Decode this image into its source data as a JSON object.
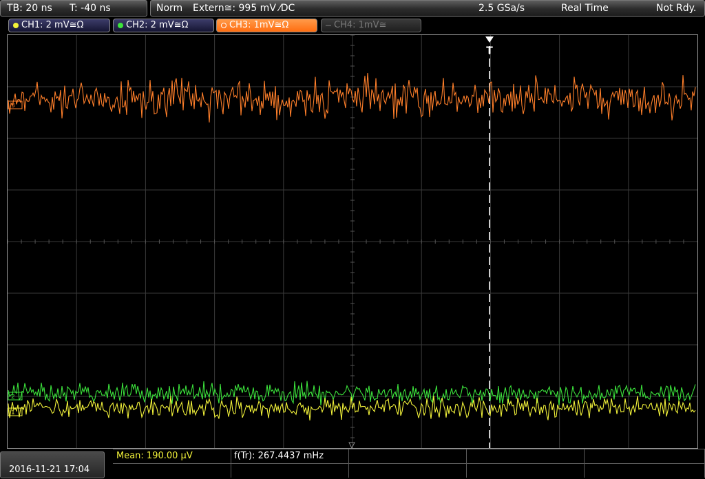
{
  "top_bar": {
    "timebase": "TB: 20 ns",
    "trigger_offset": "T: -40 ns",
    "acq_mode": "Norm",
    "trigger_info": "Extern≅: 995 mV ⁄DC",
    "sample_rate": "2.5 GSa/s",
    "time_mode": "Real Time",
    "status": "Not Rdy."
  },
  "channels": [
    {
      "label": "CH1: 2 mV≅Ω",
      "color": "#f2f23a",
      "active": true
    },
    {
      "label": "CH2: 2 mV≅Ω",
      "color": "#3ce33c",
      "active": true
    },
    {
      "label": "CH3: 1mV≅Ω",
      "color": "#ff7f2a",
      "active": true,
      "selected": true
    },
    {
      "label": "CH4: 1mV≅",
      "color": "#6a6a6a",
      "active": false
    }
  ],
  "trigger_marker": "T",
  "channel_markers": {
    "ch1": "1",
    "ch2": "2",
    "ch3": "3"
  },
  "colors": {
    "ch1": "#f2f23a",
    "ch2": "#3ce33c",
    "ch3": "#ff7f2a",
    "grid": "#3a3a3a",
    "trigger_line": "#ffffff"
  },
  "measurements": {
    "mean": "Mean: 190.00 µV",
    "freq": "f(Tr): 267.4437 mHz"
  },
  "datetime": "2016-11-21 17:04"
}
